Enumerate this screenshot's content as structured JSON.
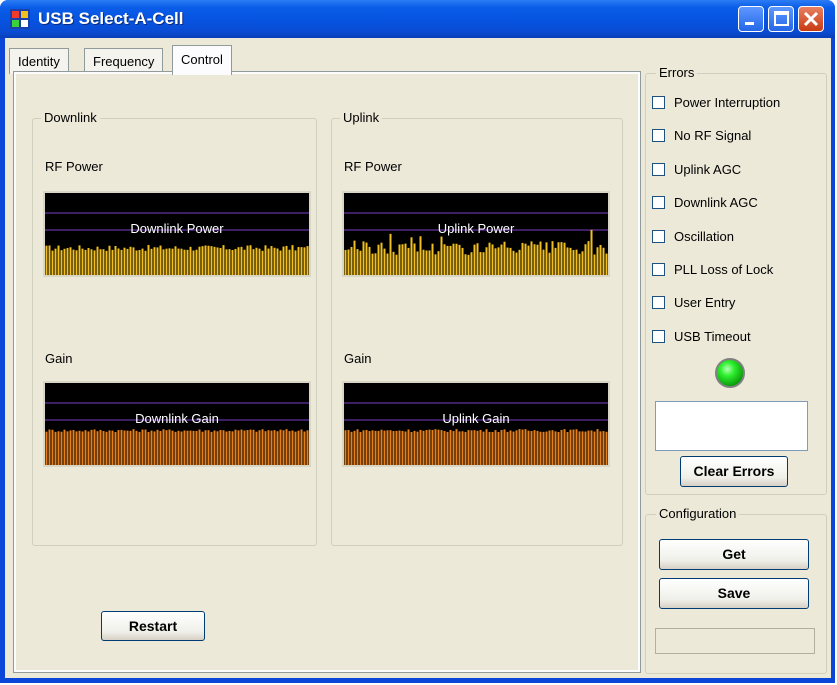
{
  "window": {
    "title": "USB Select-A-Cell"
  },
  "tabs": [
    {
      "label": "Identity",
      "active": false
    },
    {
      "label": "Frequency",
      "active": false
    },
    {
      "label": "Control",
      "active": true
    }
  ],
  "downlink": {
    "group_label": "Downlink",
    "rf_power_label": "RF Power",
    "power_meter_label": "Downlink Power",
    "gain_label": "Gain",
    "gain_meter_label": "Downlink Gain"
  },
  "uplink": {
    "group_label": "Uplink",
    "rf_power_label": "RF Power",
    "power_meter_label": "Uplink Power",
    "gain_label": "Gain",
    "gain_meter_label": "Uplink Gain"
  },
  "restart_label": "Restart",
  "errors": {
    "group_label": "Errors",
    "items": [
      {
        "label": "Power Interruption",
        "checked": false
      },
      {
        "label": "No RF Signal",
        "checked": false
      },
      {
        "label": "Uplink AGC",
        "checked": false
      },
      {
        "label": "Downlink AGC",
        "checked": false
      },
      {
        "label": "Oscillation",
        "checked": false
      },
      {
        "label": "PLL Loss of Lock",
        "checked": false
      },
      {
        "label": "User Entry",
        "checked": false
      },
      {
        "label": "USB Timeout",
        "checked": false
      }
    ],
    "status_led_color": "#2ef02e",
    "text_value": "",
    "clear_label": "Clear Errors"
  },
  "configuration": {
    "group_label": "Configuration",
    "get_label": "Get",
    "save_label": "Save",
    "status_value": ""
  },
  "colors": {
    "power_bars": "#f2c01e",
    "gain_bars": "#e8801a",
    "grid_lines": "#7a3fc8",
    "titlebar": "#0653e0"
  }
}
